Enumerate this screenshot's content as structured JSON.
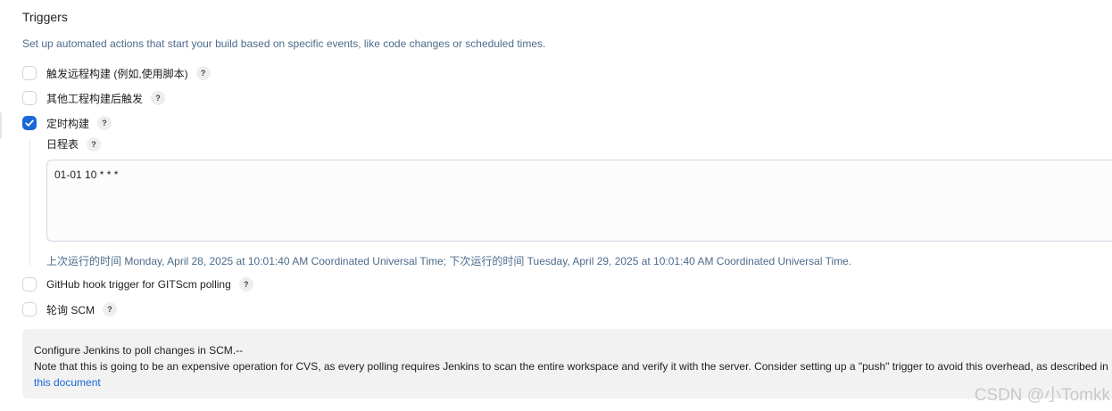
{
  "triggers": {
    "title": "Triggers",
    "description": "Set up automated actions that start your build based on specific events, like code changes or scheduled times.",
    "help_glyph": "?",
    "options": [
      {
        "label": "触发远程构建 (例如,使用脚本)",
        "checked": false
      },
      {
        "label": "其他工程构建后触发",
        "checked": false
      },
      {
        "label": "定时构建",
        "checked": true
      },
      {
        "label": "GitHub hook trigger for GITScm polling",
        "checked": false
      },
      {
        "label": "轮询 SCM",
        "checked": false
      }
    ]
  },
  "schedule": {
    "label": "日程表",
    "value": "01-01 10 * * *",
    "run_info": "上次运行的时间 Monday, April 28, 2025 at 10:01:40 AM Coordinated Universal Time; 下次运行的时间 Tuesday, April 29, 2025 at 10:01:40 AM Coordinated Universal Time."
  },
  "scm_help": {
    "line1": "Configure Jenkins to poll changes in SCM.--",
    "line2": "Note that this is going to be an expensive operation for CVS, as every polling requires Jenkins to scan the entire workspace and verify it with the server. Consider setting up a \"push\" trigger to avoid this overhead, as described in",
    "link_text": "this document"
  },
  "watermark": "CSDN @小Tomkk",
  "colors": {
    "accent": "#1868d6",
    "muted_text": "#4d6b8a",
    "help_bg": "#f2f2f2"
  }
}
